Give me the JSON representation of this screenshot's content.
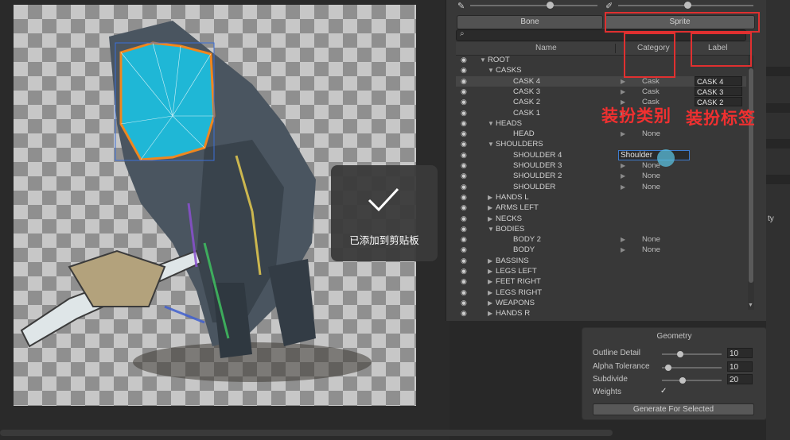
{
  "toast": {
    "message": "已添加到剪贴板"
  },
  "tabs": [
    {
      "label": "Bone"
    },
    {
      "label": "Sprite"
    }
  ],
  "columns": {
    "name": "Name",
    "category": "Category",
    "label": "Label"
  },
  "rows": [
    {
      "name": "ROOT",
      "level": 0,
      "expanded": true,
      "category": "",
      "label": ""
    },
    {
      "name": "CASKS",
      "level": 1,
      "expanded": true,
      "category": "",
      "label": ""
    },
    {
      "name": "CASK 4",
      "level": 2,
      "category": "Cask",
      "label": "CASK 4",
      "selected": true
    },
    {
      "name": "CASK 3",
      "level": 2,
      "category": "Cask",
      "label": "CASK 3"
    },
    {
      "name": "CASK 2",
      "level": 2,
      "category": "Cask",
      "label": "CASK 2"
    },
    {
      "name": "CASK 1",
      "level": 2,
      "category": "",
      "label": ""
    },
    {
      "name": "HEADS",
      "level": 1,
      "expanded": true,
      "category": "",
      "label": ""
    },
    {
      "name": "HEAD",
      "level": 2,
      "category": "None",
      "label": ""
    },
    {
      "name": "SHOULDERS",
      "level": 1,
      "expanded": true,
      "category": "",
      "label": ""
    },
    {
      "name": "SHOULDER 4",
      "level": 2,
      "category": "",
      "label": ""
    },
    {
      "name": "SHOULDER 3",
      "level": 2,
      "category": "None",
      "label": ""
    },
    {
      "name": "SHOULDER 2",
      "level": 2,
      "category": "None",
      "label": ""
    },
    {
      "name": "SHOULDER",
      "level": 2,
      "category": "None",
      "label": ""
    },
    {
      "name": "HANDS L",
      "level": 1,
      "expanded": false,
      "category": "",
      "label": ""
    },
    {
      "name": "ARMS LEFT",
      "level": 1,
      "expanded": false,
      "category": "",
      "label": ""
    },
    {
      "name": "NECKS",
      "level": 1,
      "expanded": false,
      "category": "",
      "label": ""
    },
    {
      "name": "BODIES",
      "level": 1,
      "expanded": true,
      "category": "",
      "label": ""
    },
    {
      "name": "BODY 2",
      "level": 2,
      "category": "None",
      "label": ""
    },
    {
      "name": "BODY",
      "level": 2,
      "category": "None",
      "label": ""
    },
    {
      "name": "BASSINS",
      "level": 1,
      "expanded": false,
      "category": "",
      "label": ""
    },
    {
      "name": "LEGS LEFT",
      "level": 1,
      "expanded": false,
      "category": "",
      "label": ""
    },
    {
      "name": "FEET RIGHT",
      "level": 1,
      "expanded": false,
      "category": "",
      "label": ""
    },
    {
      "name": "LEGS RIGHT",
      "level": 1,
      "expanded": false,
      "category": "",
      "label": ""
    },
    {
      "name": "WEAPONS",
      "level": 1,
      "expanded": false,
      "category": "",
      "label": ""
    },
    {
      "name": "HANDS R",
      "level": 1,
      "expanded": false,
      "category": "",
      "label": ""
    }
  ],
  "category_edit": {
    "value": "Shoulder"
  },
  "annotations": {
    "category": "装扮类别",
    "label": "装扮标签"
  },
  "geometry": {
    "title": "Geometry",
    "outline_detail": {
      "label": "Outline Detail",
      "value": "10",
      "fraction": 0.3
    },
    "alpha_tolerance": {
      "label": "Alpha Tolerance",
      "value": "10",
      "fraction": 0.1
    },
    "subdivide": {
      "label": "Subdivide",
      "value": "20",
      "fraction": 0.35
    },
    "weights": {
      "label": "Weights",
      "checked": true
    },
    "generate_button": "Generate For Selected"
  },
  "strip": {
    "partial_text": "ty"
  },
  "colors": {
    "accent_blue": "#3d7ccf",
    "annotation_red": "#e03030",
    "mesh_cyan": "#20b8d8"
  }
}
